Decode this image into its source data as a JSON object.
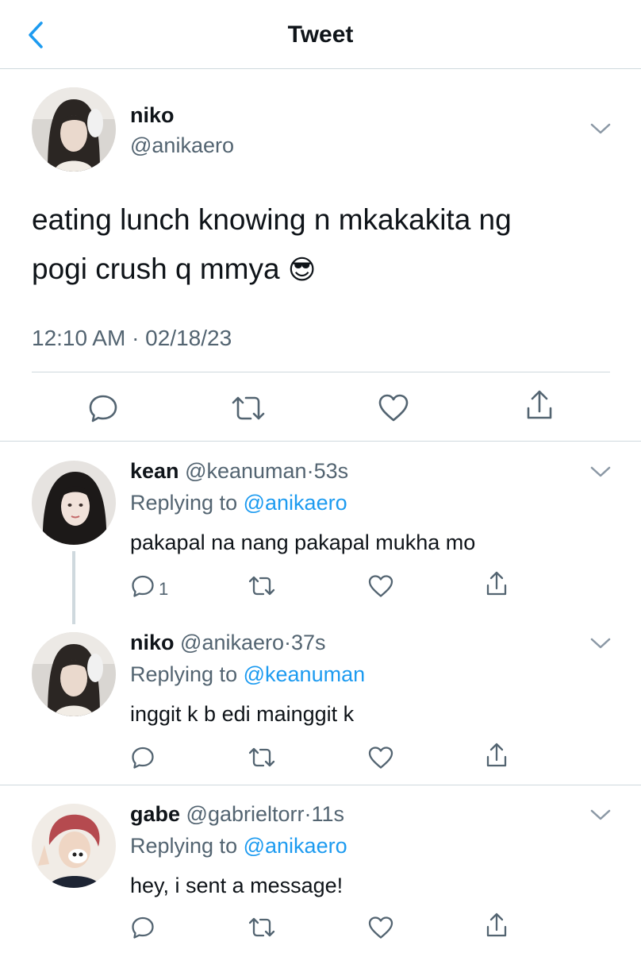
{
  "header": {
    "title": "Tweet",
    "back_icon": "chevron-left-icon"
  },
  "tweet": {
    "name": "niko",
    "handle": "@anikaero",
    "text_line1": "eating lunch knowing n mkakakita ng",
    "text_line2": "pogi crush q mmya",
    "emoji": "😎",
    "timestamp": "12:10 AM · 02/18/23"
  },
  "replies": [
    {
      "name": "kean",
      "handle": "@keanuman",
      "sep": "·",
      "time": "53s",
      "replying_label": "Replying to",
      "replying_to": "@anikaero",
      "text": "pakapal na nang pakapal mukha mo",
      "reply_count": "1"
    },
    {
      "name": "niko",
      "handle": "@anikaero",
      "sep": "·",
      "time": "37s",
      "replying_label": "Replying to",
      "replying_to": "@keanuman",
      "text": "inggit k b edi mainggit k",
      "reply_count": ""
    },
    {
      "name": "gabe",
      "handle": "@gabrieltorr",
      "sep": "·",
      "time": "11s",
      "replying_label": "Replying to",
      "replying_to": "@anikaero",
      "text": "hey, i sent a message!",
      "reply_count": ""
    }
  ],
  "colors": {
    "accent": "#1d9bf0",
    "text": "#0f1419",
    "muted": "#536471",
    "divider": "#cfd9de"
  }
}
